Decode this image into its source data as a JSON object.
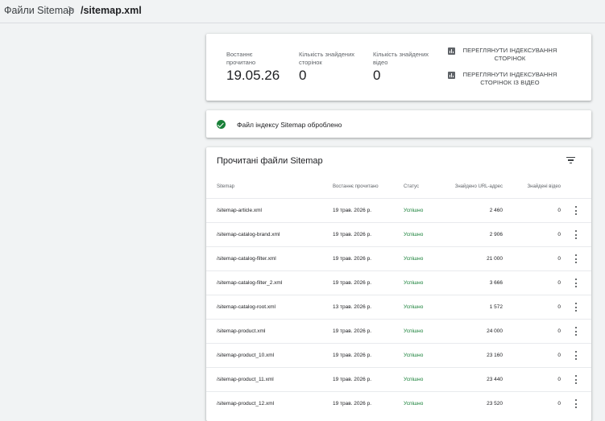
{
  "breadcrumb": {
    "parent": "Файли Sitemap",
    "separator": ">",
    "current": "/sitemap.xml"
  },
  "summary": {
    "last_read_label": "Востаннє прочитано",
    "last_read_value": "19.05.26",
    "pages_label": "Кількість знайдених сторінок",
    "pages_value": "0",
    "videos_label": "Кількість знайдених відео",
    "videos_value": "0",
    "view_pages_button": "ПЕРЕГЛЯНУТИ ІНДЕКСУВАННЯ СТОРІНОК",
    "view_video_button": "ПЕРЕГЛЯНУТИ ІНДЕКСУВАННЯ СТОРІНОК ІЗ ВІДЕО",
    "icon": "bar-chart-icon"
  },
  "status": {
    "icon": "check-circle-icon",
    "text": "Файл індексу Sitemap оброблено",
    "color": "#188038"
  },
  "table": {
    "title": "Прочитані файли Sitemap",
    "filter_icon": "filter-icon",
    "headers": {
      "sitemap": "Sitemap",
      "last_read": "Востаннє прочитано",
      "status": "Статус",
      "urls": "Знайдено URL-адрес",
      "videos": "Знайдені відео"
    },
    "rows": [
      {
        "sitemap": "/sitemap-article.xml",
        "last_read": "19 трав. 2026 р.",
        "status": "Успішно",
        "urls": "2 460",
        "videos": "0"
      },
      {
        "sitemap": "/sitemap-catalog-brand.xml",
        "last_read": "19 трав. 2026 р.",
        "status": "Успішно",
        "urls": "2 906",
        "videos": "0"
      },
      {
        "sitemap": "/sitemap-catalog-filter.xml",
        "last_read": "19 трав. 2026 р.",
        "status": "Успішно",
        "urls": "21 000",
        "videos": "0"
      },
      {
        "sitemap": "/sitemap-catalog-filter_2.xml",
        "last_read": "19 трав. 2026 р.",
        "status": "Успішно",
        "urls": "3 666",
        "videos": "0"
      },
      {
        "sitemap": "/sitemap-catalog-root.xml",
        "last_read": "13 трав. 2026 р.",
        "status": "Успішно",
        "urls": "1 572",
        "videos": "0"
      },
      {
        "sitemap": "/sitemap-product.xml",
        "last_read": "19 трав. 2026 р.",
        "status": "Успішно",
        "urls": "24 000",
        "videos": "0"
      },
      {
        "sitemap": "/sitemap-product_10.xml",
        "last_read": "19 трав. 2026 р.",
        "status": "Успішно",
        "urls": "23 160",
        "videos": "0"
      },
      {
        "sitemap": "/sitemap-product_11.xml",
        "last_read": "19 трав. 2026 р.",
        "status": "Успішно",
        "urls": "23 440",
        "videos": "0"
      },
      {
        "sitemap": "/sitemap-product_12.xml",
        "last_read": "19 трав. 2026 р.",
        "status": "Успішно",
        "urls": "23 520",
        "videos": "0"
      }
    ]
  },
  "colors": {
    "success": "#188038",
    "background": "#f1f3f4",
    "card": "#ffffff"
  }
}
